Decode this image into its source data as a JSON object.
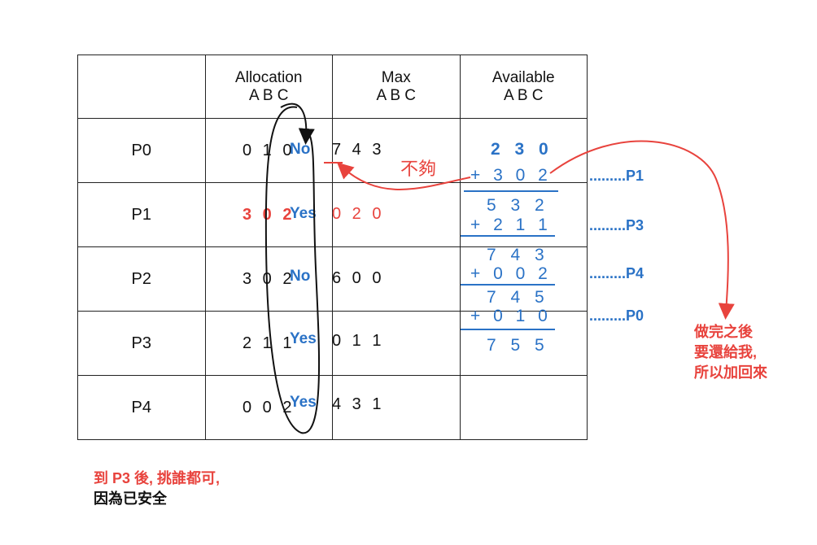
{
  "headers": {
    "allocation": "Allocation",
    "max": "Max",
    "available": "Available",
    "abc": "A B C"
  },
  "rows": [
    {
      "process": "P0",
      "allocation": "0 1 0",
      "answer": "No",
      "max": "7 4 3"
    },
    {
      "process": "P1",
      "allocation": "3 0 2",
      "answer": "Yes",
      "max": "0 2 0"
    },
    {
      "process": "P2",
      "allocation": "3 0 2",
      "answer": "No",
      "max": "6 0 0"
    },
    {
      "process": "P3",
      "allocation": "2 1 1",
      "answer": "Yes",
      "max": "0 1 1"
    },
    {
      "process": "P4",
      "allocation": "0 0 2",
      "answer": "Yes",
      "max": "4 3 1"
    }
  ],
  "available_calc": {
    "start": "2 3 0",
    "steps": [
      {
        "add": "+ 3 0 2",
        "result": "5 3 2",
        "label": ".........P1"
      },
      {
        "add": "+ 2 1 1",
        "result": "7 4 3",
        "label": ".........P3"
      },
      {
        "add": "+ 0 0 2",
        "result": "7 4 5",
        "label": ".........P4"
      },
      {
        "add": "+ 0 1 0",
        "result": "7 5 5",
        "label": ".........P0"
      }
    ]
  },
  "annotations": {
    "not_enough": "不夠",
    "return_note": [
      "做完之後",
      "要還給我,",
      "所以加回來"
    ],
    "bottom_note_1": "到 P3 後, 挑誰都可,",
    "bottom_note_2": "因為已安全"
  },
  "colors": {
    "red": "#e8433d",
    "blue": "#2a72c6",
    "grid": "#222222"
  }
}
